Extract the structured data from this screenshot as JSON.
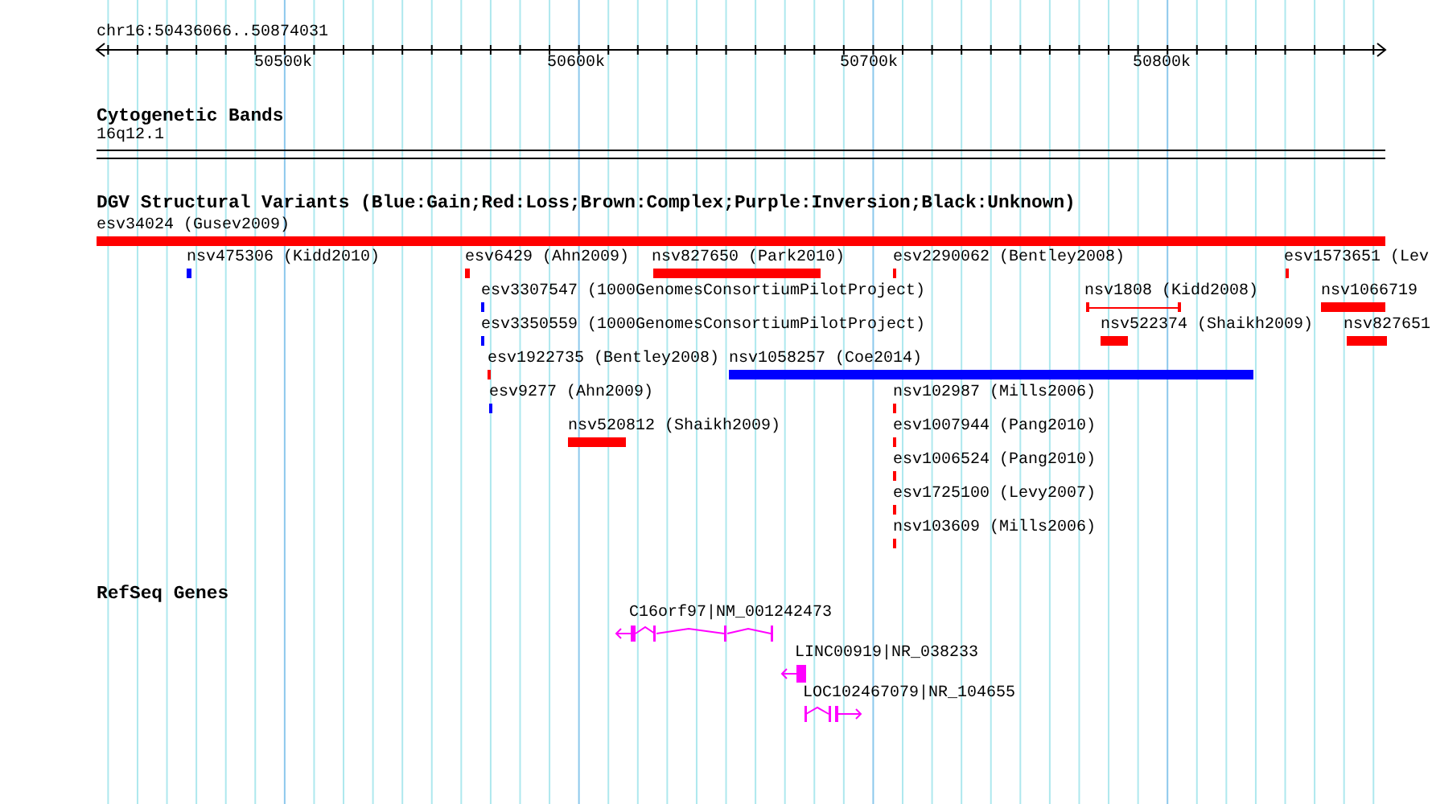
{
  "ruler": {
    "range": "chr16:50436066..50874031",
    "ticks": [
      "50500k",
      "50600k",
      "50700k",
      "50800k"
    ]
  },
  "cytogenetic_bands": {
    "title": "Cytogenetic Bands",
    "bands": [
      "16q12.1"
    ]
  },
  "dgv_variants": {
    "title": "DGV Structural Variants (Blue:Gain;Red:Loss;Brown:Complex;Purple:Inversion;Black:Unknown)",
    "variants": [
      {
        "label": "esv34024 (Gusev2009)",
        "color": "#ff0000",
        "kind": "block"
      },
      {
        "label": "nsv475306 (Kidd2010)",
        "color": "#0000ff",
        "kind": "block"
      },
      {
        "label": "esv6429 (Ahn2009)",
        "color": "#ff0000",
        "kind": "block"
      },
      {
        "label": "nsv827650 (Park2010)",
        "color": "#ff0000",
        "kind": "block"
      },
      {
        "label": "esv2290062 (Bentley2008)",
        "color": "#ff0000",
        "kind": "block"
      },
      {
        "label": "esv1573651 (Lev",
        "color": "#ff0000",
        "kind": "block"
      },
      {
        "label": "esv3307547 (1000GenomesConsortiumPilotProject)",
        "color": "#0000ff",
        "kind": "block"
      },
      {
        "label": "nsv1808 (Kidd2008)",
        "color": "#ff0000",
        "kind": "span"
      },
      {
        "label": "nsv1066719",
        "color": "#ff0000",
        "kind": "block"
      },
      {
        "label": "esv3350559 (1000GenomesConsortiumPilotProject)",
        "color": "#0000ff",
        "kind": "block"
      },
      {
        "label": "nsv522374 (Shaikh2009)",
        "color": "#ff0000",
        "kind": "block"
      },
      {
        "label": "nsv827651",
        "color": "#ff0000",
        "kind": "block"
      },
      {
        "label": "esv1922735 (Bentley2008)",
        "color": "#ff0000",
        "kind": "block"
      },
      {
        "label": "nsv1058257 (Coe2014)",
        "color": "#0000ff",
        "kind": "block"
      },
      {
        "label": "esv9277 (Ahn2009)",
        "color": "#0000ff",
        "kind": "block"
      },
      {
        "label": "nsv102987 (Mills2006)",
        "color": "#ff0000",
        "kind": "block"
      },
      {
        "label": "nsv520812 (Shaikh2009)",
        "color": "#ff0000",
        "kind": "block"
      },
      {
        "label": "esv1007944 (Pang2010)",
        "color": "#ff0000",
        "kind": "block"
      },
      {
        "label": "esv1006524 (Pang2010)",
        "color": "#ff0000",
        "kind": "block"
      },
      {
        "label": "esv1725100 (Levy2007)",
        "color": "#ff0000",
        "kind": "block"
      },
      {
        "label": "nsv103609 (Mills2006)",
        "color": "#ff0000",
        "kind": "block"
      }
    ]
  },
  "refseq_genes": {
    "title": "RefSeq Genes",
    "genes": [
      {
        "label": "C16orf97|NM_001242473",
        "minus_strand": true
      },
      {
        "label": "LINC00919|NR_038233",
        "minus_strand": true
      },
      {
        "label": "LOC102467079|NR_104655",
        "minus_strand": false
      }
    ]
  }
}
